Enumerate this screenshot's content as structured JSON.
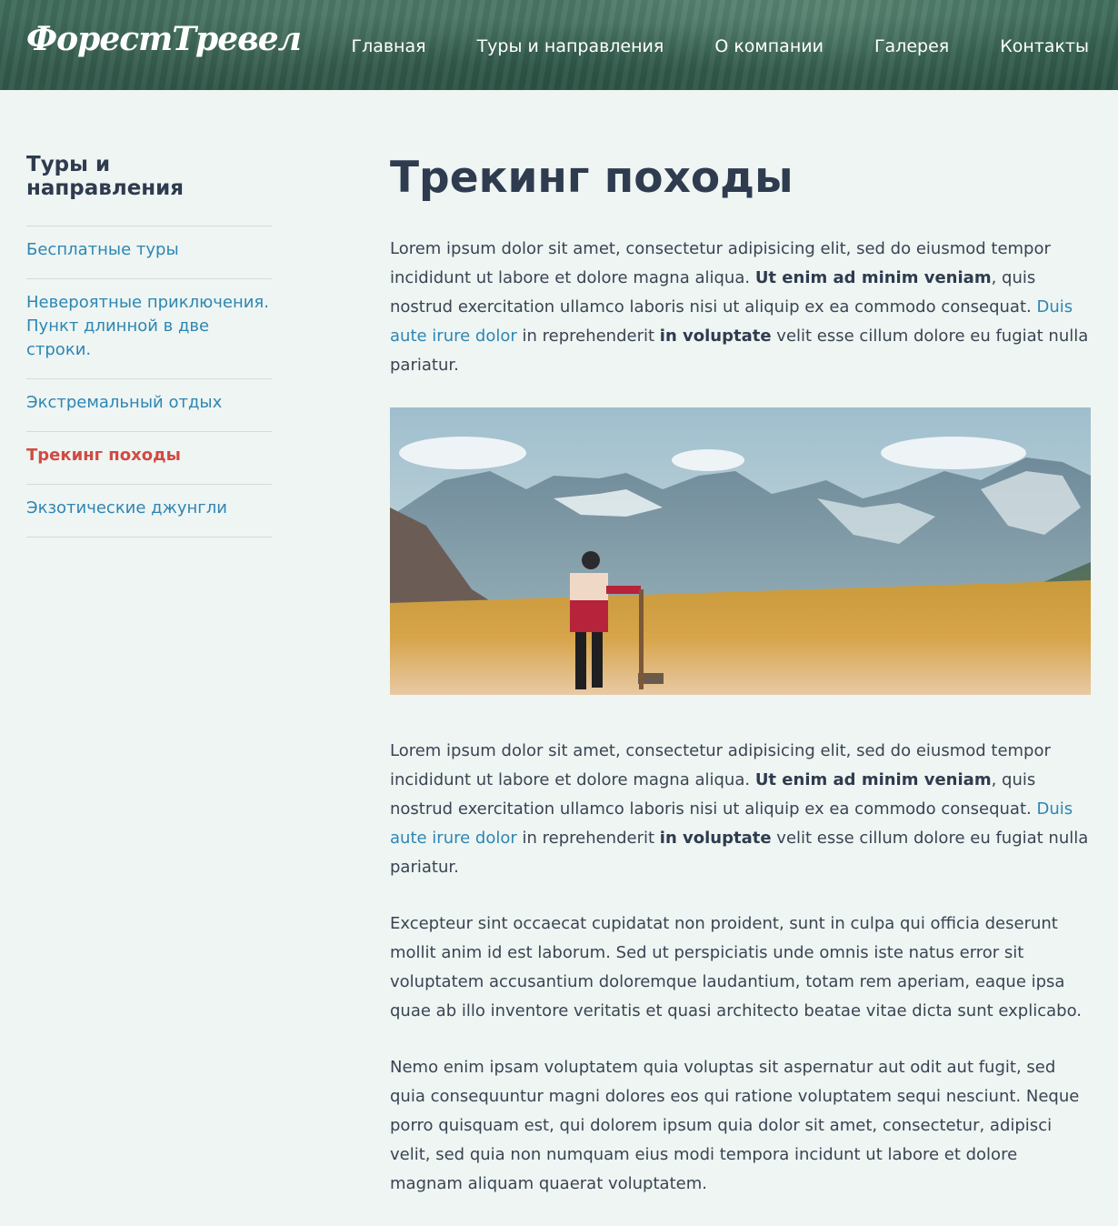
{
  "header": {
    "logo": "ФорестТревел",
    "nav": [
      "Главная",
      "Туры и направления",
      "О компании",
      "Галерея",
      "Контакты"
    ]
  },
  "sidebar": {
    "title": "Туры и направления",
    "items": [
      {
        "label": "Бесплатные туры"
      },
      {
        "label": "Невероятные приключения. Пункт длинной в две строки."
      },
      {
        "label": "Экстремальный отдых"
      },
      {
        "label": "Трекинг походы",
        "active": true
      },
      {
        "label": "Экзотические джунгли"
      }
    ]
  },
  "main": {
    "title": "Трекинг походы",
    "p1": {
      "t1": "Lorem ipsum dolor sit amet, consectetur adipisicing elit, sed do eiusmod tempor incididunt ut labore et dolore magna aliqua. ",
      "b1": "Ut enim ad minim veniam",
      "t2": ", quis nostrud exercitation ullamco laboris nisi ut aliquip ex ea commodo consequat. ",
      "link": "Duis aute irure dolor",
      "t3": " in reprehenderit ",
      "b2": "in voluptate",
      "t4": " velit esse cillum dolore eu fugiat nulla pariatur."
    },
    "p2": {
      "t1": "Lorem ipsum dolor sit amet, consectetur adipisicing elit, sed do eiusmod tempor incididunt ut labore et dolore magna aliqua. ",
      "b1": "Ut enim ad minim veniam",
      "t2": ", quis nostrud exercitation ullamco laboris nisi ut aliquip ex ea commodo consequat. ",
      "link": "Duis aute irure dolor",
      "t3": " in reprehenderit ",
      "b2": "in voluptate",
      "t4": " velit esse cillum dolore eu fugiat nulla pariatur."
    },
    "p3": "Excepteur sint occaecat cupidatat non proident, sunt in culpa qui officia deserunt mollit anim id est laborum. Sed ut perspiciatis unde omnis iste natus error sit voluptatem accusantium doloremque laudantium, totam rem aperiam, eaque ipsa quae ab illo inventore veritatis et quasi architecto beatae vitae dicta sunt explicabo.",
    "p4": "Nemo enim ipsam voluptatem quia voluptas sit aspernatur aut odit aut fugit, sed quia consequuntur magni dolores eos qui ratione voluptatem sequi nesciunt. Neque porro quisquam est, qui dolorem ipsum quia dolor sit amet, consectetur, adipisci velit, sed quia non numquam eius modi tempora incidunt ut labore et dolore magnam aliquam quaerat voluptatem."
  },
  "colors": {
    "header": "#44705f",
    "page_bg": "#eef5f2",
    "link": "#2e86b4",
    "active": "#d24a43",
    "text": "#2f3b4f"
  }
}
